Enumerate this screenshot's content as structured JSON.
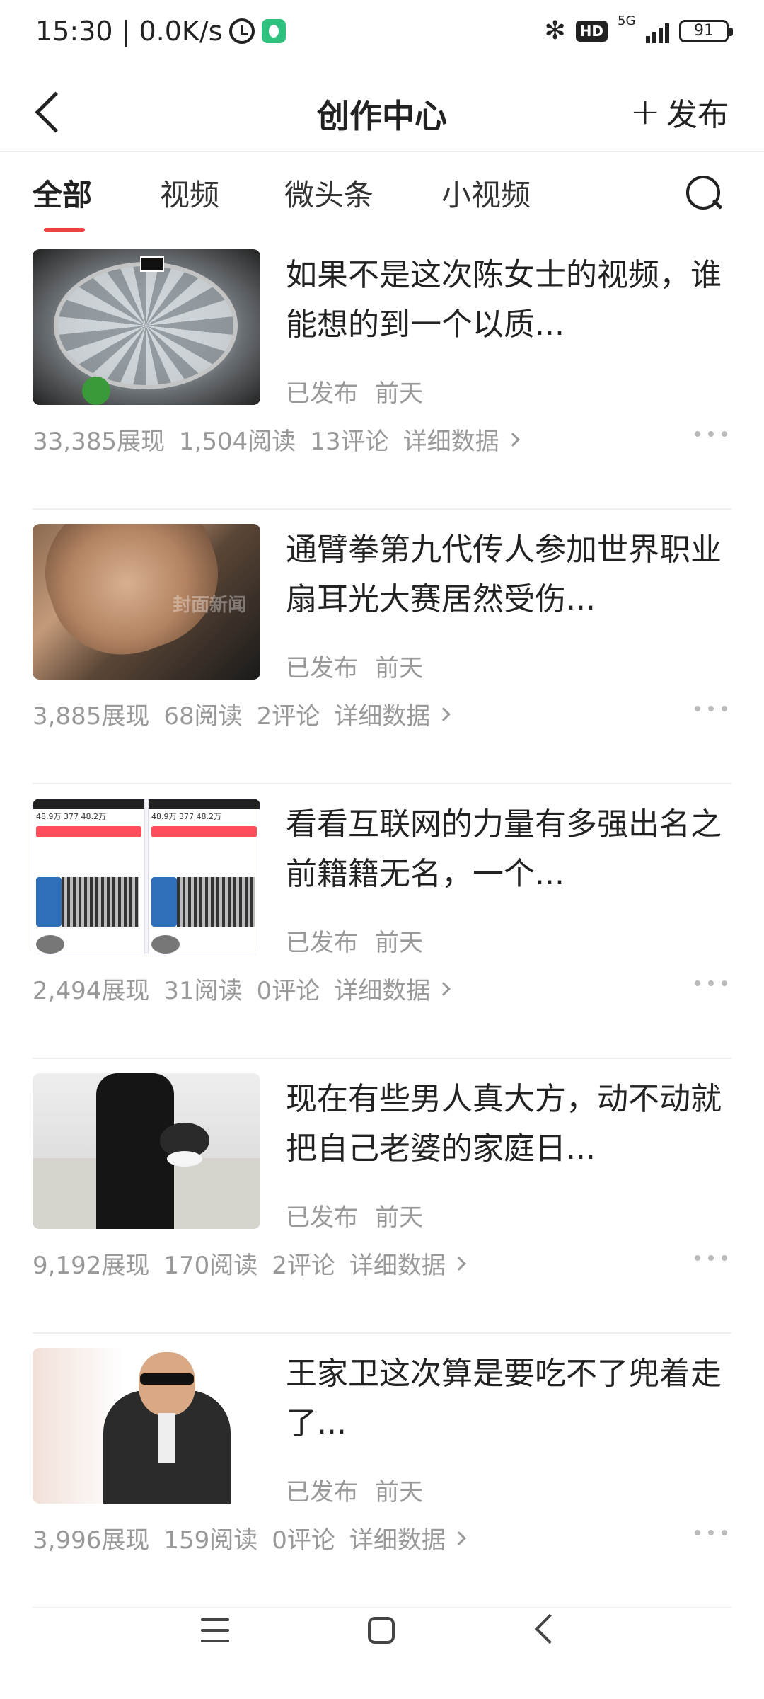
{
  "status_bar": {
    "time_speed": "15:30 | 0.0K/s",
    "network": "5G",
    "hd": "HD",
    "battery": "91"
  },
  "header": {
    "title": "创作中心",
    "publish_label": "发布"
  },
  "tabs": [
    {
      "label": "全部",
      "active": true
    },
    {
      "label": "视频",
      "active": false
    },
    {
      "label": "微头条",
      "active": false
    },
    {
      "label": "小视频",
      "active": false
    }
  ],
  "items": [
    {
      "title": "如果不是这次陈女士的视频，谁能想的到一个以质...",
      "status": "已发布",
      "time": "前天",
      "impressions": "33,385展现",
      "reads": "1,504阅读",
      "comments": "13评论",
      "detail": "详细数据"
    },
    {
      "title": "通臂拳第九代传人参加世界职业扇耳光大赛居然受伤...",
      "status": "已发布",
      "time": "前天",
      "impressions": "3,885展现",
      "reads": "68阅读",
      "comments": "2评论",
      "detail": "详细数据",
      "thumb_watermark": "封面新闻"
    },
    {
      "title": "看看互联网的力量有多强出名之前籍籍无名，一个...",
      "status": "已发布",
      "time": "前天",
      "impressions": "2,494展现",
      "reads": "31阅读",
      "comments": "0评论",
      "detail": "详细数据"
    },
    {
      "title": "现在有些男人真大方，动不动就把自己老婆的家庭日...",
      "status": "已发布",
      "time": "前天",
      "impressions": "9,192展现",
      "reads": "170阅读",
      "comments": "2评论",
      "detail": "详细数据"
    },
    {
      "title": "王家卫这次算是要吃不了兜着走了...",
      "status": "已发布",
      "time": "前天",
      "impressions": "3,996展现",
      "reads": "159阅读",
      "comments": "0评论",
      "detail": "详细数据"
    }
  ],
  "colors": {
    "accent": "#f04142",
    "meta": "#999999"
  }
}
